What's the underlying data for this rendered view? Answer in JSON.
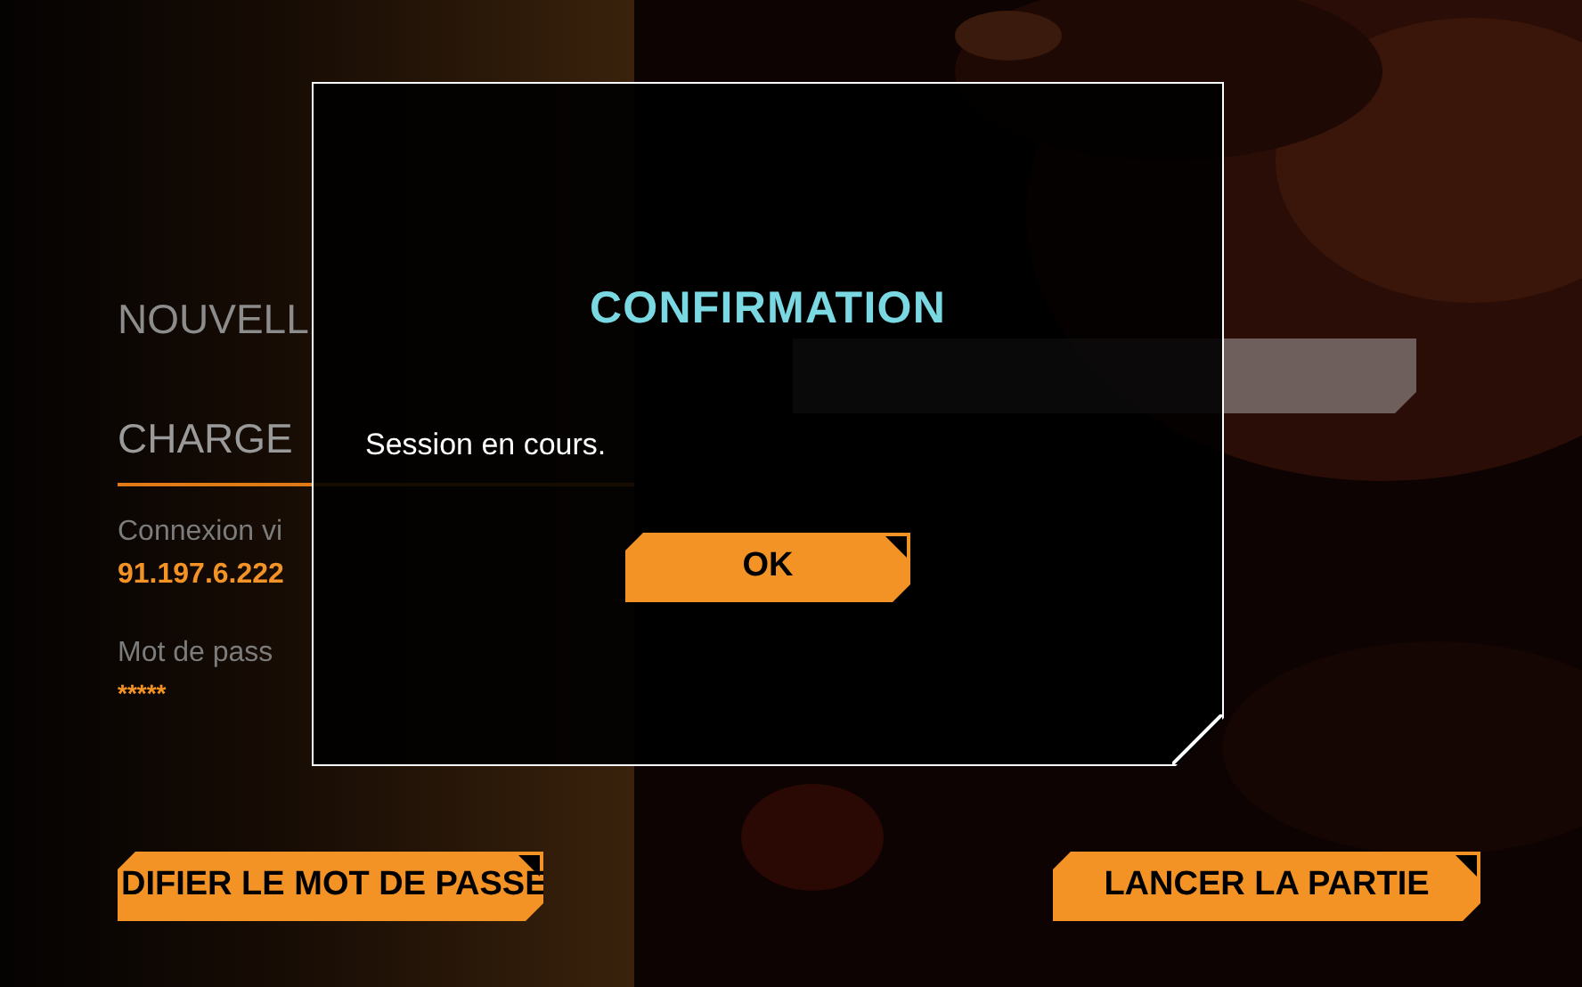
{
  "menu": [
    {
      "label": "NOUVELL",
      "selected": false
    },
    {
      "label": "CHARGE",
      "selected": true
    }
  ],
  "connection": {
    "label": "Connexion vi",
    "value": "91.197.6.222"
  },
  "password": {
    "label": "Mot de pass",
    "value": "*****"
  },
  "buttons": [
    {
      "label": "DIFIER LE MOT DE PASSE"
    },
    {
      "label": "LANCER LA PARTIE"
    }
  ],
  "dialog": {
    "title": "CONFIRMATION",
    "message": "Session en cours.",
    "button": "OK"
  }
}
